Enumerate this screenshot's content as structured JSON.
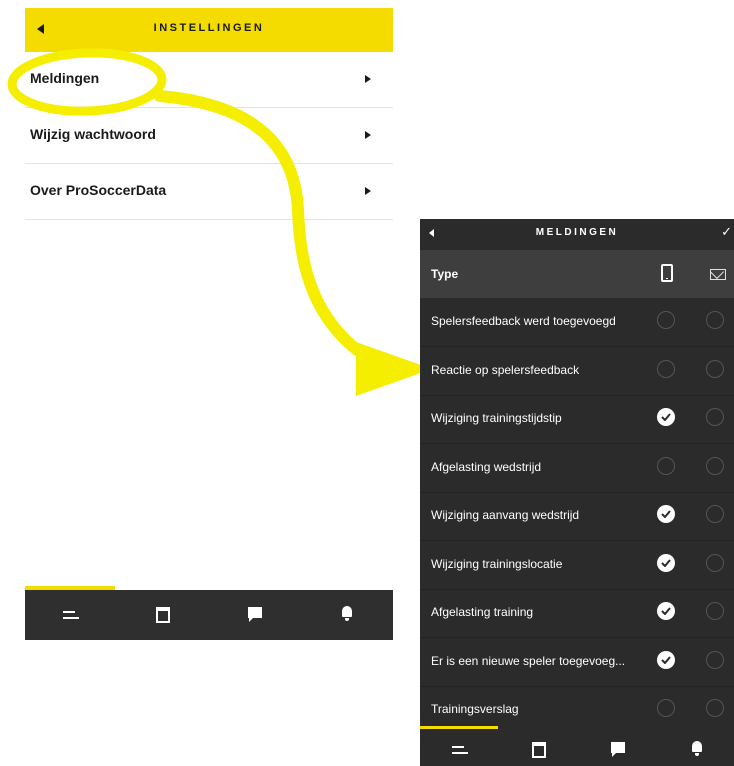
{
  "settings": {
    "title": "INSTELLINGEN",
    "items": [
      {
        "label": "Meldingen"
      },
      {
        "label": "Wijzig wachtwoord"
      },
      {
        "label": "Over ProSoccerData"
      }
    ]
  },
  "tabbar": {
    "tabs": [
      {
        "icon": "list-icon"
      },
      {
        "icon": "calendar-icon"
      },
      {
        "icon": "chat-icon"
      },
      {
        "icon": "bell-icon"
      }
    ],
    "active_tab": 0
  },
  "notifications": {
    "title": "MELDINGEN",
    "header": {
      "type_label": "Type",
      "push_icon": "phone-icon",
      "mail_icon": "mail-icon",
      "confirm_icon": "checkmark-icon"
    },
    "rows": [
      {
        "label": "Spelersfeedback werd toegevoegd",
        "push": false,
        "mail": false
      },
      {
        "label": "Reactie op spelersfeedback",
        "push": false,
        "mail": false
      },
      {
        "label": "Wijziging trainingstijdstip",
        "push": true,
        "mail": false
      },
      {
        "label": "Afgelasting wedstrijd",
        "push": false,
        "mail": false
      },
      {
        "label": "Wijziging aanvang wedstrijd",
        "push": true,
        "mail": false
      },
      {
        "label": "Wijziging trainingslocatie",
        "push": true,
        "mail": false
      },
      {
        "label": "Afgelasting training",
        "push": true,
        "mail": false
      },
      {
        "label": "Er is een nieuwe speler toegevoeg...",
        "push": true,
        "mail": false
      },
      {
        "label": "Trainingsverslag",
        "push": false,
        "mail": false
      }
    ]
  },
  "colors": {
    "accent": "#f4dc00",
    "dark": "#2b2b2b",
    "header_row": "#3e3e3e",
    "tabbar_light": "#2f2f2f"
  }
}
